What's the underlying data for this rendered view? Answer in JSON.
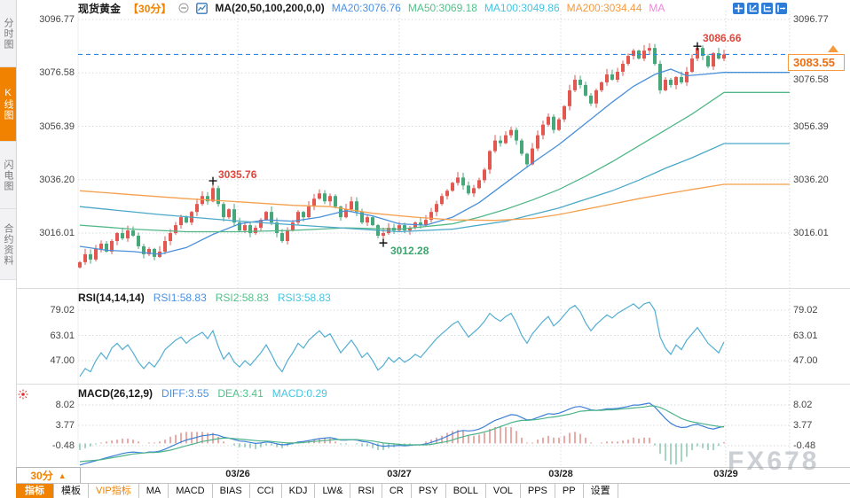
{
  "header": {
    "title": "现货黄金",
    "period": "【30分】",
    "ma_settings": "MA(20,50,100,200,0,0)",
    "ma_values": [
      {
        "label": "MA20:3076.76",
        "color": "#4a90e2"
      },
      {
        "label": "MA50:3069.18",
        "color": "#53c08a"
      },
      {
        "label": "MA100:3049.86",
        "color": "#45c5e0"
      },
      {
        "label": "MA200:3034.44",
        "color": "#f59a3e"
      },
      {
        "label": "MA",
        "color": "#ea8ad8"
      }
    ]
  },
  "sidebar": {
    "tabs": [
      {
        "label": "分时图",
        "active": false
      },
      {
        "label": "K线图",
        "active": true
      },
      {
        "label": "闪电图",
        "active": false
      },
      {
        "label": "合约资料",
        "active": false
      }
    ]
  },
  "main_chart": {
    "axis_labels": [
      "3096.77",
      "3076.58",
      "3056.39",
      "3036.20",
      "3016.01"
    ],
    "current_price": "3083.55",
    "annotations": {
      "high1": "3035.76",
      "low1": "3012.28",
      "high2": "3086.66"
    }
  },
  "rsi_panel": {
    "title": "RSI(14,14,14)",
    "values": [
      {
        "label": "RSI1:58.83",
        "color": "#4a90e2"
      },
      {
        "label": "RSI2:58.83",
        "color": "#53c08a"
      },
      {
        "label": "RSI3:58.83",
        "color": "#45c5e0"
      }
    ],
    "axis_labels": [
      "79.02",
      "63.01",
      "47.00"
    ]
  },
  "macd_panel": {
    "title": "MACD(26,12,9)",
    "values": [
      {
        "label": "DIFF:3.55",
        "color": "#4a90e2"
      },
      {
        "label": "DEA:3.41",
        "color": "#53c08a"
      },
      {
        "label": "MACD:0.29",
        "color": "#45c5e0"
      }
    ],
    "axis_labels": [
      "8.02",
      "3.77",
      "-0.48"
    ]
  },
  "time_axis": {
    "period": "30分",
    "dropdown_arrow": "▲",
    "dates": [
      "03/26",
      "03/27",
      "03/28",
      "03/29"
    ]
  },
  "toolbar": {
    "buttons": [
      {
        "label": "指标",
        "style": "active"
      },
      {
        "label": "模板"
      },
      {
        "label": "VIP指标",
        "style": "vip"
      },
      {
        "label": "MA"
      },
      {
        "label": "MACD"
      },
      {
        "label": "BIAS"
      },
      {
        "label": "CCI"
      },
      {
        "label": "KDJ"
      },
      {
        "label": "LW&"
      },
      {
        "label": "RSI"
      },
      {
        "label": "CR"
      },
      {
        "label": "PSY"
      },
      {
        "label": "BOLL"
      },
      {
        "label": "VOL"
      },
      {
        "label": "PPS"
      },
      {
        "label": "PP"
      },
      {
        "label": "设置"
      }
    ]
  },
  "watermark": "FX678",
  "colors": {
    "up": "#e25750",
    "down": "#46a878",
    "accent": "#f08200",
    "price_line": "#2f86e0",
    "grid": "#d5d9de",
    "hist_up": "#d4574e",
    "hist_down": "#4fae85",
    "rsi_line": "#52aed2",
    "diff_line": "#3d7fd6",
    "dea_line": "#4db38a"
  },
  "chart_data": {
    "type": "candlestick",
    "instrument": "现货黄金",
    "interval": "30min",
    "x_axis": {
      "dates": [
        "03/26",
        "03/27",
        "03/28",
        "03/29"
      ]
    },
    "y_axis_labels": [
      3096.77,
      3076.58,
      3056.39,
      3036.2,
      3016.01
    ],
    "current_price": 3083.55,
    "first_open": 3003,
    "closes": [
      3005,
      3008,
      3006,
      3010,
      3012,
      3009,
      3013,
      3016,
      3014,
      3017,
      3015,
      3011,
      3008,
      3010,
      3007,
      3009,
      3013,
      3016,
      3019,
      3022,
      3020,
      3024,
      3027,
      3030,
      3028,
      3033,
      3027,
      3022,
      3025,
      3020,
      3017,
      3019,
      3016,
      3018,
      3021,
      3024,
      3020,
      3016,
      3013,
      3017,
      3020,
      3024,
      3022,
      3026,
      3029,
      3031,
      3028,
      3030,
      3026,
      3022,
      3025,
      3028,
      3024,
      3020,
      3022,
      3019,
      3015,
      3016,
      3018,
      3017,
      3019,
      3017,
      3018,
      3020,
      3019,
      3021,
      3024,
      3027,
      3030,
      3032,
      3035,
      3037,
      3034,
      3031,
      3033,
      3036,
      3040,
      3047,
      3051,
      3050,
      3053,
      3055,
      3051,
      3046,
      3042,
      3048,
      3053,
      3057,
      3060,
      3055,
      3059,
      3064,
      3070,
      3074,
      3072,
      3068,
      3065,
      3070,
      3073,
      3076,
      3074,
      3077,
      3080,
      3083,
      3085,
      3082,
      3085,
      3086,
      3080,
      3070,
      3074,
      3072,
      3075,
      3073,
      3077,
      3082,
      3086,
      3083,
      3079,
      3084,
      3082,
      3083.55
    ],
    "extremes": [
      {
        "index": 25,
        "type": "high",
        "value": 3035.76
      },
      {
        "index": 57,
        "type": "low",
        "value": 3012.28
      },
      {
        "index": 116,
        "type": "high",
        "value": 3086.66
      }
    ],
    "ma": {
      "MA20": {
        "color": "#4a90d9",
        "last": 3076.76,
        "anchors": [
          [
            0,
            3011
          ],
          [
            5,
            3009.5
          ],
          [
            10,
            3009
          ],
          [
            15,
            3008
          ],
          [
            20,
            3010.5
          ],
          [
            25,
            3015.5
          ],
          [
            30,
            3019.5
          ],
          [
            35,
            3021
          ],
          [
            40,
            3020.5
          ],
          [
            45,
            3022
          ],
          [
            50,
            3024.5
          ],
          [
            55,
            3022.5
          ],
          [
            60,
            3019.5
          ],
          [
            65,
            3019
          ],
          [
            70,
            3022
          ],
          [
            75,
            3027.5
          ],
          [
            80,
            3035
          ],
          [
            85,
            3042.5
          ],
          [
            90,
            3049.5
          ],
          [
            95,
            3057.5
          ],
          [
            100,
            3065.5
          ],
          [
            104,
            3071.5
          ],
          [
            108,
            3076
          ],
          [
            111,
            3078
          ],
          [
            114,
            3075.5
          ],
          [
            117,
            3076
          ],
          [
            121,
            3076.76
          ]
        ]
      },
      "MA50": {
        "color": "#52b788",
        "last": 3069.18,
        "anchors": [
          [
            0,
            3019
          ],
          [
            10,
            3017.5
          ],
          [
            20,
            3016.5
          ],
          [
            30,
            3016.5
          ],
          [
            40,
            3017
          ],
          [
            50,
            3018
          ],
          [
            60,
            3017.5
          ],
          [
            70,
            3019.5
          ],
          [
            75,
            3022
          ],
          [
            80,
            3025
          ],
          [
            85,
            3028.5
          ],
          [
            90,
            3032.5
          ],
          [
            95,
            3037.5
          ],
          [
            100,
            3043
          ],
          [
            105,
            3049
          ],
          [
            110,
            3055
          ],
          [
            115,
            3061
          ],
          [
            121,
            3069.18
          ]
        ]
      },
      "MA100": {
        "color": "#4aa8c8",
        "last": 3049.86,
        "anchors": [
          [
            0,
            3026
          ],
          [
            15,
            3023
          ],
          [
            30,
            3020.5
          ],
          [
            45,
            3018.5
          ],
          [
            60,
            3016.5
          ],
          [
            70,
            3017.5
          ],
          [
            80,
            3020.5
          ],
          [
            90,
            3025.5
          ],
          [
            100,
            3032
          ],
          [
            105,
            3036
          ],
          [
            110,
            3040.5
          ],
          [
            115,
            3044.5
          ],
          [
            121,
            3049.86
          ]
        ]
      },
      "MA200": {
        "color": "#f5a04e",
        "last": 3034.44,
        "anchors": [
          [
            0,
            3032
          ],
          [
            10,
            3030.5
          ],
          [
            20,
            3029
          ],
          [
            30,
            3027.8
          ],
          [
            40,
            3026.5
          ],
          [
            47,
            3026
          ],
          [
            55,
            3023.5
          ],
          [
            63,
            3022
          ],
          [
            70,
            3021
          ],
          [
            78,
            3020.8
          ],
          [
            85,
            3021.5
          ],
          [
            90,
            3023
          ],
          [
            95,
            3025
          ],
          [
            100,
            3027
          ],
          [
            105,
            3029
          ],
          [
            110,
            3030.8
          ],
          [
            115,
            3032.5
          ],
          [
            121,
            3034.44
          ]
        ]
      }
    },
    "rsi": {
      "axis": [
        79.02,
        63.01,
        47.0
      ],
      "current": 58.83,
      "values": [
        37,
        42,
        40,
        47,
        52,
        48,
        55,
        58,
        54,
        57,
        52,
        46,
        42,
        46,
        43,
        48,
        54,
        57,
        60,
        62,
        58,
        61,
        63,
        65,
        61,
        66,
        56,
        48,
        52,
        46,
        43,
        47,
        44,
        48,
        52,
        57,
        51,
        44,
        40,
        47,
        52,
        58,
        55,
        60,
        63,
        66,
        62,
        64,
        58,
        52,
        56,
        60,
        55,
        49,
        52,
        47,
        41,
        44,
        49,
        46,
        49,
        46,
        48,
        51,
        49,
        53,
        57,
        61,
        64,
        67,
        70,
        72,
        67,
        62,
        65,
        68,
        72,
        77,
        74,
        72,
        75,
        77,
        71,
        63,
        58,
        64,
        68,
        72,
        75,
        69,
        72,
        76,
        80,
        82,
        78,
        71,
        66,
        70,
        73,
        76,
        74,
        77,
        79,
        81,
        83,
        80,
        83,
        84,
        79,
        62,
        55,
        51,
        57,
        54,
        60,
        64,
        68,
        63,
        58,
        55,
        52,
        58.83
      ]
    },
    "macd": {
      "axis": [
        8.02,
        3.77,
        -0.48
      ],
      "diff_last": 3.55,
      "dea_last": 3.41,
      "hist_last": 0.29,
      "diff": [
        -4.5,
        -4.2,
        -3.9,
        -3.6,
        -3.3,
        -3.0,
        -2.7,
        -2.4,
        -2.1,
        -1.9,
        -1.8,
        -1.9,
        -2.0,
        -1.8,
        -1.8,
        -1.6,
        -1.2,
        -0.7,
        -0.2,
        0.3,
        0.7,
        1.0,
        1.3,
        1.6,
        1.7,
        1.9,
        1.7,
        1.3,
        1.1,
        0.8,
        0.5,
        0.4,
        0.2,
        0.0,
        0.1,
        0.3,
        0.2,
        -0.1,
        -0.3,
        -0.2,
        0.0,
        0.3,
        0.4,
        0.6,
        0.8,
        1.0,
        1.1,
        1.2,
        1.0,
        0.7,
        0.7,
        0.8,
        0.7,
        0.4,
        0.3,
        0.0,
        -0.4,
        -0.6,
        -0.5,
        -0.5,
        -0.4,
        -0.5,
        -0.4,
        -0.3,
        -0.3,
        -0.1,
        0.2,
        0.6,
        1.0,
        1.5,
        2.0,
        2.5,
        2.7,
        2.6,
        2.7,
        3.0,
        3.5,
        4.2,
        4.8,
        5.2,
        5.6,
        6.0,
        5.9,
        5.4,
        4.9,
        5.0,
        5.4,
        5.8,
        6.2,
        6.1,
        6.3,
        6.7,
        7.2,
        7.6,
        7.7,
        7.4,
        7.0,
        6.9,
        7.0,
        7.2,
        7.2,
        7.3,
        7.5,
        7.7,
        8.0,
        8.0,
        8.2,
        8.4,
        7.6,
        6.4,
        5.2,
        4.2,
        3.6,
        3.3,
        3.4,
        3.8,
        4.0,
        3.6,
        3.2,
        3.0,
        3.3,
        3.55
      ],
      "dea": [
        -3.8,
        -3.7,
        -3.6,
        -3.5,
        -3.4,
        -3.2,
        -3.0,
        -2.8,
        -2.6,
        -2.4,
        -2.2,
        -2.1,
        -2.0,
        -1.9,
        -1.9,
        -1.8,
        -1.6,
        -1.4,
        -1.1,
        -0.8,
        -0.5,
        -0.2,
        0.1,
        0.4,
        0.6,
        0.8,
        1.0,
        1.1,
        1.1,
        1.0,
        0.9,
        0.8,
        0.7,
        0.6,
        0.5,
        0.5,
        0.4,
        0.3,
        0.2,
        0.1,
        0.1,
        0.1,
        0.2,
        0.3,
        0.4,
        0.5,
        0.6,
        0.7,
        0.8,
        0.8,
        0.8,
        0.8,
        0.8,
        0.7,
        0.6,
        0.5,
        0.3,
        0.1,
        0.0,
        -0.1,
        -0.2,
        -0.3,
        -0.3,
        -0.3,
        -0.3,
        -0.3,
        -0.2,
        0.0,
        0.2,
        0.4,
        0.7,
        1.1,
        1.4,
        1.7,
        1.9,
        2.1,
        2.4,
        2.7,
        3.1,
        3.5,
        3.9,
        4.3,
        4.6,
        4.8,
        4.8,
        4.9,
        5.0,
        5.2,
        5.4,
        5.5,
        5.7,
        5.9,
        6.1,
        6.4,
        6.7,
        6.8,
        6.9,
        6.9,
        6.9,
        7.0,
        7.0,
        7.1,
        7.2,
        7.3,
        7.4,
        7.5,
        7.6,
        7.8,
        7.8,
        7.5,
        7.0,
        6.4,
        5.8,
        5.2,
        4.8,
        4.5,
        4.3,
        4.1,
        3.9,
        3.7,
        3.55,
        3.41
      ]
    }
  }
}
